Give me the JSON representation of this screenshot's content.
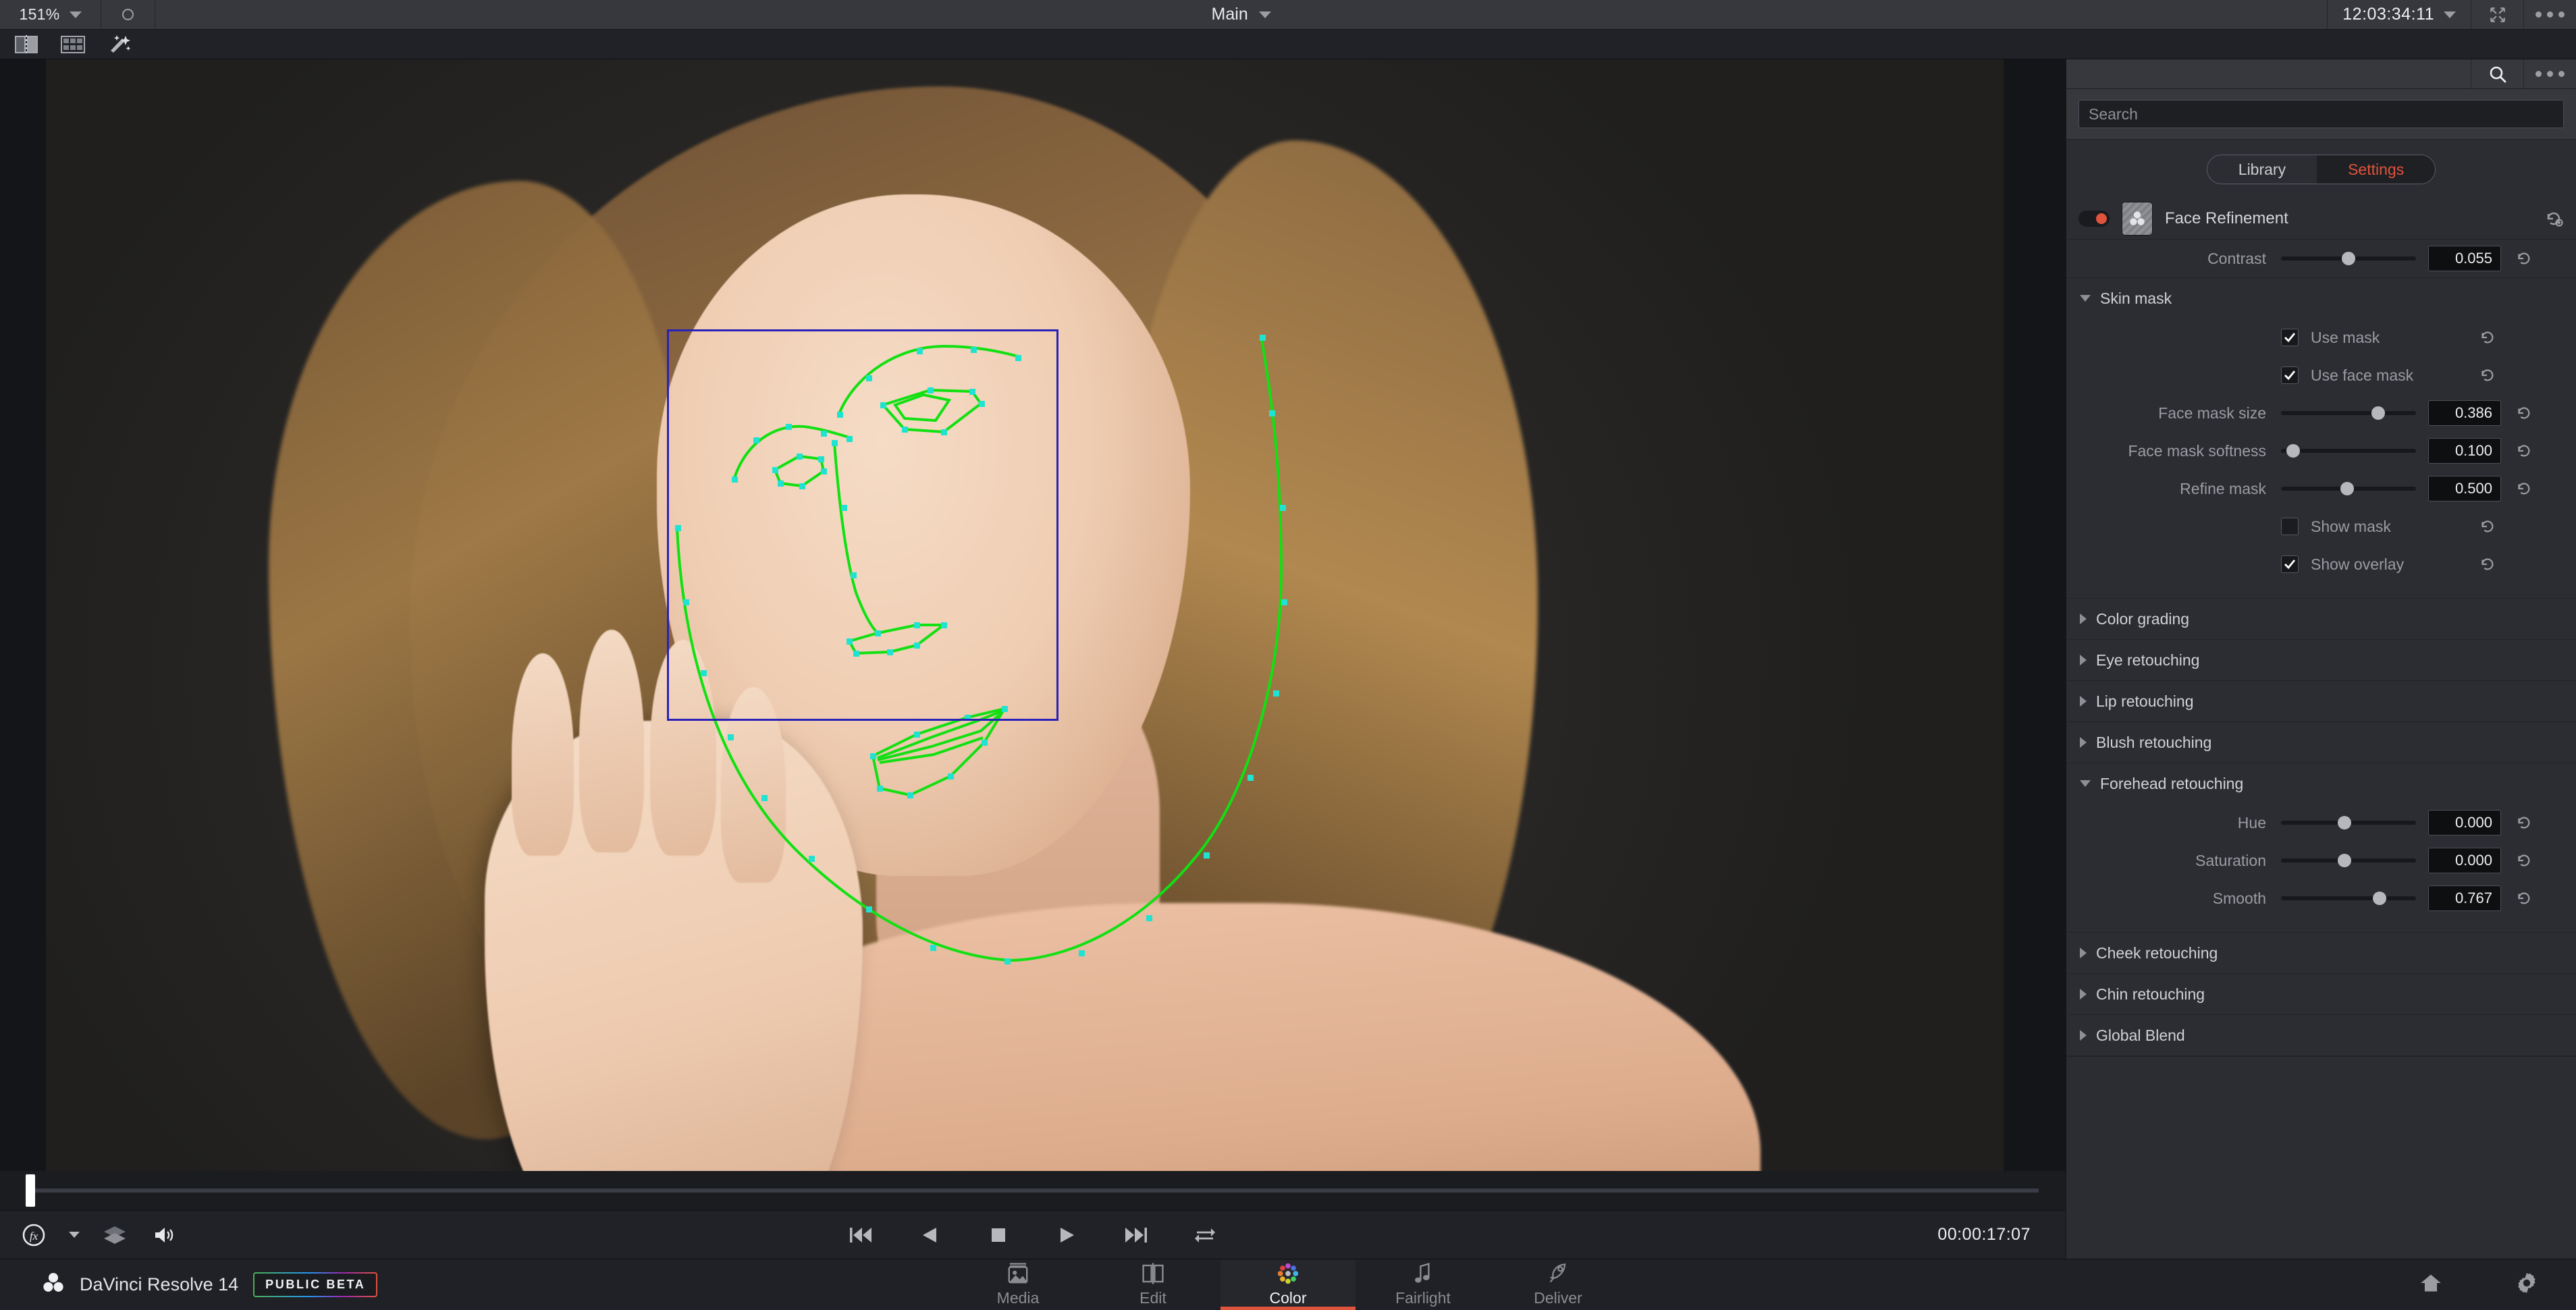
{
  "topbar": {
    "zoom_level": "151%",
    "zoom_chevron_icon": "chevron-down-icon",
    "bypass_icon": "circle-icon",
    "viewer_title": "Main",
    "title_chevron_icon": "chevron-down-icon",
    "timecode": "12:03:34:11",
    "timecode_chevron_icon": "chevron-down-icon",
    "fullscreen_icon": "expand-arrows-icon",
    "options_icon": "more-options-icon"
  },
  "toolbar2": {
    "items": [
      {
        "icon": "split-screen-icon",
        "name": "split-screen-button"
      },
      {
        "icon": "grid-layout-icon",
        "name": "image-wipe-button"
      },
      {
        "icon": "magic-wand-icon",
        "name": "magic-mask-button"
      }
    ]
  },
  "viewer": {
    "tracker_box_color": "#2a21b8",
    "mesh_color": "#12e012",
    "mesh_point_color": "#1fe3d0"
  },
  "transport": {
    "fx_icon": "fx-circle-icon",
    "fx_chevron_icon": "chevron-down-icon",
    "layers_icon": "layers-icon",
    "audio_icon": "speaker-icon",
    "buttons": [
      {
        "icon": "skip-to-start-icon",
        "name": "jump-to-first-frame-button"
      },
      {
        "icon": "play-reverse-icon",
        "name": "play-reverse-button"
      },
      {
        "icon": "stop-icon",
        "name": "stop-button"
      },
      {
        "icon": "play-icon",
        "name": "play-forward-button"
      },
      {
        "icon": "skip-to-end-icon",
        "name": "jump-to-last-frame-button"
      },
      {
        "icon": "loop-icon",
        "name": "loop-button"
      }
    ],
    "current_timecode": "00:00:17:07"
  },
  "inspector": {
    "search_icon": "search-icon",
    "options_icon": "more-options-icon",
    "search_placeholder": "Search",
    "search_value": "",
    "tabs": [
      {
        "label": "Library",
        "active": false
      },
      {
        "label": "Settings",
        "active": true
      }
    ],
    "accent_color": "#e0533c",
    "effect": {
      "enabled": true,
      "name": "Face Refinement",
      "reset_icon": "reset-icon",
      "thumb_icon": "resolve-fx-icon"
    },
    "top_param": {
      "label": "Contrast",
      "value": "0.055",
      "slider_pct": 50,
      "reset_icon": "reset-icon"
    },
    "sections": [
      {
        "title": "Skin mask",
        "expanded": true,
        "checks": [
          {
            "label": "Use mask",
            "checked": true
          },
          {
            "label": "Use face mask",
            "checked": true
          }
        ],
        "params": [
          {
            "label": "Face mask size",
            "value": "0.386",
            "slider_pct": 72
          },
          {
            "label": "Face mask softness",
            "value": "0.100",
            "slider_pct": 9
          },
          {
            "label": "Refine mask",
            "value": "0.500",
            "slider_pct": 49
          }
        ],
        "checks_after": [
          {
            "label": "Show mask",
            "checked": false
          },
          {
            "label": "Show overlay",
            "checked": true
          }
        ]
      },
      {
        "title": "Color grading",
        "expanded": false
      },
      {
        "title": "Eye retouching",
        "expanded": false
      },
      {
        "title": "Lip retouching",
        "expanded": false
      },
      {
        "title": "Blush retouching",
        "expanded": false
      },
      {
        "title": "Forehead retouching",
        "expanded": true,
        "params": [
          {
            "label": "Hue",
            "value": "0.000",
            "slider_pct": 47
          },
          {
            "label": "Saturation",
            "value": "0.000",
            "slider_pct": 47
          },
          {
            "label": "Smooth",
            "value": "0.767",
            "slider_pct": 73
          }
        ]
      },
      {
        "title": "Cheek retouching",
        "expanded": false
      },
      {
        "title": "Chin retouching",
        "expanded": false
      },
      {
        "title": "Global Blend",
        "expanded": false
      }
    ]
  },
  "statusbar": {
    "logo_icon": "resolve-logo-icon",
    "app_title": "DaVinci Resolve 14",
    "badge": "PUBLIC BETA",
    "pages": [
      {
        "label": "Media",
        "icon": "media-icon",
        "active": false
      },
      {
        "label": "Edit",
        "icon": "edit-icon",
        "active": false
      },
      {
        "label": "Color",
        "icon": "color-wheel-icon",
        "active": true
      },
      {
        "label": "Fairlight",
        "icon": "music-note-icon",
        "active": false
      },
      {
        "label": "Deliver",
        "icon": "rocket-icon",
        "active": false
      }
    ],
    "home_icon": "home-icon",
    "settings_icon": "gear-icon"
  }
}
